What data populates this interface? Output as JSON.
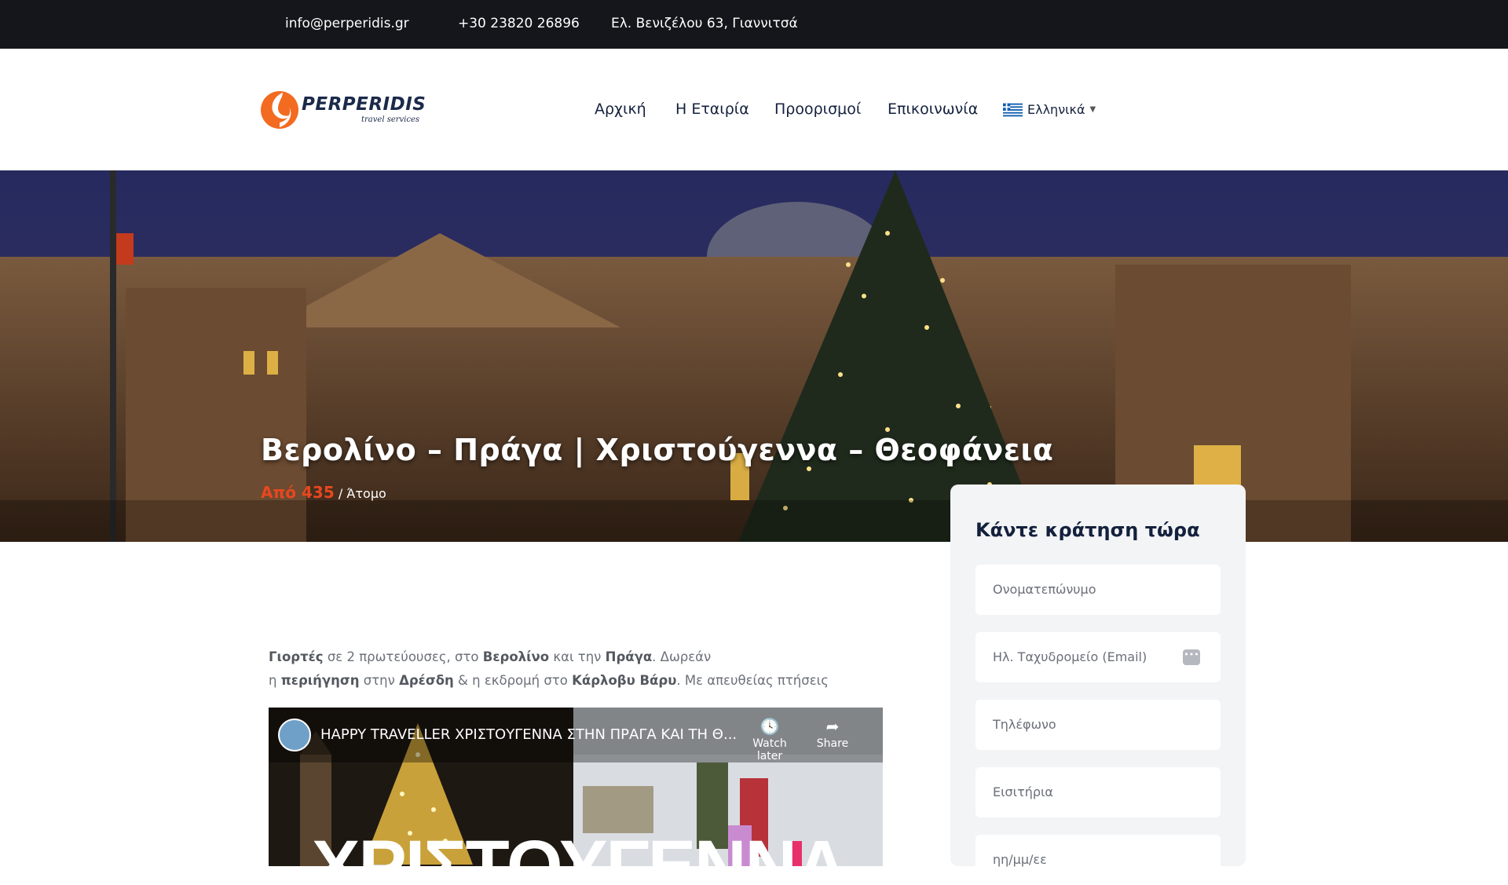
{
  "topbar": {
    "email": "info@perperidis.gr",
    "phone": "+30 23820 26896",
    "address": "Ελ. Βενιζέλου 63, Γιαννιτσά"
  },
  "logo": {
    "name": "PERPERIDIS",
    "tagline": "travel services",
    "icon": "orange-swirl-logo"
  },
  "nav": {
    "items": [
      "Αρχική",
      "Η Εταιρία",
      "Προορισμοί",
      "Επικοινωνία"
    ],
    "language": "Ελληνικά",
    "language_icon": "greek-flag-icon"
  },
  "hero": {
    "title": "Βερολίνο – Πράγα | Χριστούγεννα – Θεοφάνεια",
    "price_from": "Από 435",
    "price_unit": "/ Άτομο",
    "price_color": "#e8471f"
  },
  "intro": {
    "line1": [
      {
        "t": "Γιορτές",
        "b": true
      },
      {
        "t": " σε 2 πρωτεύουσες, στο ",
        "b": false
      },
      {
        "t": "Βερολίνο",
        "b": true
      },
      {
        "t": " και την ",
        "b": false
      },
      {
        "t": "Πράγα",
        "b": true
      },
      {
        "t": ". Δωρεάν",
        "b": false
      }
    ],
    "line2": [
      {
        "t": "η ",
        "b": false
      },
      {
        "t": "περιήγηση",
        "b": true
      },
      {
        "t": " στην ",
        "b": false
      },
      {
        "t": "Δρέσδη",
        "b": true
      },
      {
        "t": " & η εκδρομή στο ",
        "b": false
      },
      {
        "t": "Κάρλοβυ Βάρυ",
        "b": true
      },
      {
        "t": ". Με απευθείας πτήσεις",
        "b": false
      }
    ]
  },
  "video": {
    "title": "HAPPY TRAVELLER ΧΡΙΣΤΟΥΓΕΝΝΑ ΣΤΗΝ ΠΡΑΓΑ ΚΑΙ ΤΗ Θ...",
    "watch_later": "Watch later",
    "share": "Share",
    "overlay_text": "ΧΡΙΣΤΟΥΓΕΝΝΑ"
  },
  "booking": {
    "title": "Κάντε κράτηση τώρα",
    "fields": [
      {
        "placeholder": "Ονοματεπώνυμο"
      },
      {
        "placeholder": "Ηλ. Ταχυδρομείο (Email)"
      },
      {
        "placeholder": "Τηλέφωνο"
      },
      {
        "placeholder": "Εισιτήρια"
      },
      {
        "placeholder": "ηη/μμ/εε"
      }
    ]
  },
  "colors": {
    "topbar_bg": "#14161b",
    "accent": "#e8471f",
    "navy": "#14213d",
    "card_bg": "#f3f4f6"
  }
}
